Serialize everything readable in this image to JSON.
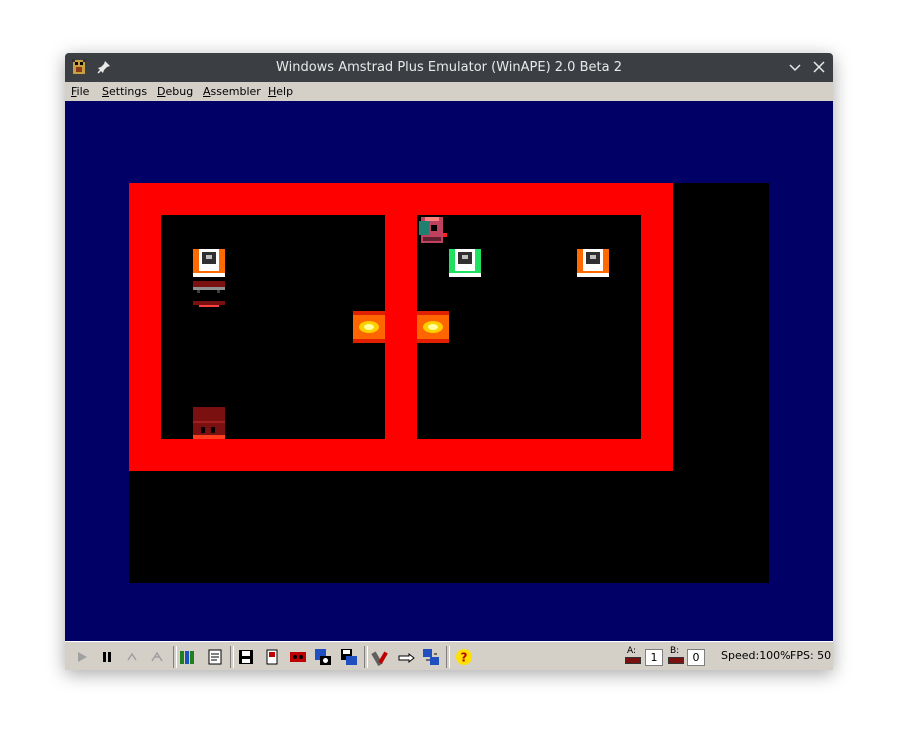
{
  "window": {
    "title": "Windows Amstrad Plus Emulator (WinAPE) 2.0 Beta 2"
  },
  "menu": [
    {
      "u": "F",
      "rest": "ile"
    },
    {
      "u": "S",
      "rest": "ettings"
    },
    {
      "u": "D",
      "rest": "ebug"
    },
    {
      "u": "A",
      "rest": "ssembler"
    },
    {
      "u": "H",
      "rest": "elp"
    }
  ],
  "status": {
    "drive_a_label": "A:",
    "drive_a_value": "1",
    "drive_b_label": "B:",
    "drive_b_value": "0",
    "speed": "Speed:100%",
    "fps": "FPS: 50"
  },
  "colors": {
    "border": "#000066",
    "wall": "#ff0000",
    "floor": "#000000"
  }
}
